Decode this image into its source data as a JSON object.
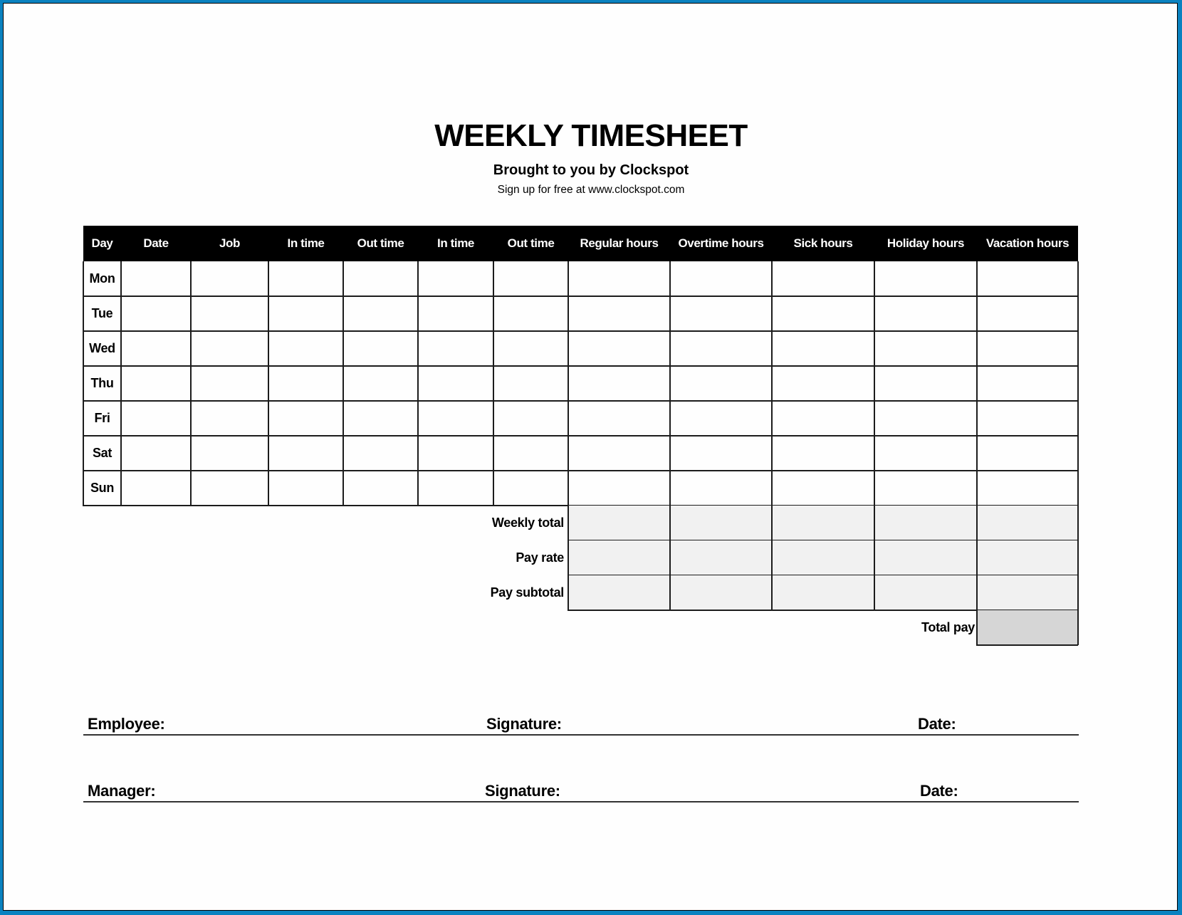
{
  "colors": {
    "frame": "#0a82c0",
    "header_bg": "#000000",
    "header_text": "#ffffff",
    "totals_fill": "#f1f1f1",
    "total_pay_fill": "#d6d6d6"
  },
  "header": {
    "title": "WEEKLY TIMESHEET",
    "subtitle": "Brought to you by Clockspot",
    "signup": "Sign up for free at www.clockspot.com"
  },
  "table": {
    "columns": [
      "Day",
      "Date",
      "Job",
      "In time",
      "Out time",
      "In time",
      "Out time",
      "Regular hours",
      "Overtime hours",
      "Sick hours",
      "Holiday hours",
      "Vacation hours"
    ],
    "rows": [
      {
        "day": "Mon",
        "values": [
          "",
          "",
          "",
          "",
          "",
          "",
          "",
          "",
          "",
          "",
          ""
        ]
      },
      {
        "day": "Tue",
        "values": [
          "",
          "",
          "",
          "",
          "",
          "",
          "",
          "",
          "",
          "",
          ""
        ]
      },
      {
        "day": "Wed",
        "values": [
          "",
          "",
          "",
          "",
          "",
          "",
          "",
          "",
          "",
          "",
          ""
        ]
      },
      {
        "day": "Thu",
        "values": [
          "",
          "",
          "",
          "",
          "",
          "",
          "",
          "",
          "",
          "",
          ""
        ]
      },
      {
        "day": "Fri",
        "values": [
          "",
          "",
          "",
          "",
          "",
          "",
          "",
          "",
          "",
          "",
          ""
        ]
      },
      {
        "day": "Sat",
        "values": [
          "",
          "",
          "",
          "",
          "",
          "",
          "",
          "",
          "",
          "",
          ""
        ]
      },
      {
        "day": "Sun",
        "values": [
          "",
          "",
          "",
          "",
          "",
          "",
          "",
          "",
          "",
          "",
          ""
        ]
      }
    ]
  },
  "totals": {
    "rows": [
      {
        "label": "Weekly total",
        "values": [
          "",
          "",
          "",
          "",
          ""
        ]
      },
      {
        "label": "Pay rate",
        "values": [
          "",
          "",
          "",
          "",
          ""
        ]
      },
      {
        "label": "Pay subtotal",
        "values": [
          "",
          "",
          "",
          "",
          ""
        ]
      }
    ],
    "total_pay": {
      "label": "Total pay",
      "value": ""
    }
  },
  "signatures": {
    "rows": [
      {
        "name_label": "Employee:",
        "signature_label": "Signature:",
        "date_label": "Date:",
        "name": "",
        "signature": "",
        "date": ""
      },
      {
        "name_label": "Manager:",
        "signature_label": "Signature:",
        "date_label": "Date:",
        "name": "",
        "signature": "",
        "date": ""
      }
    ]
  }
}
